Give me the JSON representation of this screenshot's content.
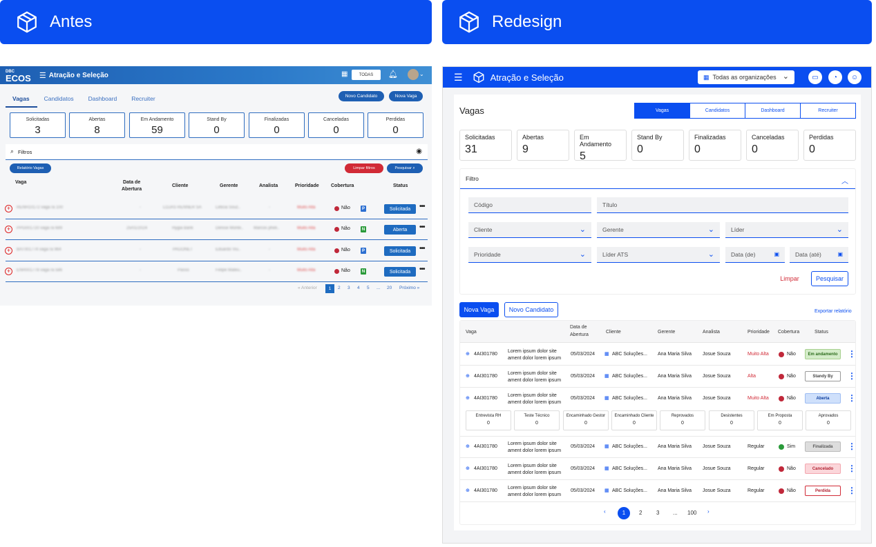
{
  "banners": {
    "before": "Antes",
    "after": "Redesign"
  },
  "old": {
    "logo_small": "DBC",
    "logo": "ECOS",
    "title": "Atração e Seleção",
    "org": "TODAS",
    "tabs": [
      "Vagas",
      "Candidatos",
      "Dashboard",
      "Recruiter"
    ],
    "btn_new_candidate": "Novo Candidato",
    "btn_new_job": "Nova Vaga",
    "cards": [
      {
        "label": "Solicitadas",
        "value": "3"
      },
      {
        "label": "Abertas",
        "value": "8"
      },
      {
        "label": "Em Andamento",
        "value": "59"
      },
      {
        "label": "Stand By",
        "value": "0"
      },
      {
        "label": "Finalizadas",
        "value": "0"
      },
      {
        "label": "Canceladas",
        "value": "0"
      },
      {
        "label": "Perdidas",
        "value": "0"
      }
    ],
    "filter_label": "Filtros",
    "btn_report": "Relatório Vagas",
    "btn_clear": "Limpar filtros",
    "btn_search": "Pesquisar",
    "headers": {
      "vaga": "Vaga",
      "data1": "Data de",
      "data2": "Abertura",
      "cliente": "Cliente",
      "gerente": "Gerente",
      "analista": "Analista",
      "prioridade": "Prioridade",
      "cobertura": "Cobertura",
      "status": "Status"
    },
    "rows": [
      {
        "vaga": "RENH10172 vaga ra 100",
        "data": "-",
        "cliente": "LOJAS RENNER SA",
        "gerente": "Leticia Souz..",
        "analista": "-",
        "prioridade": "Muito Alta",
        "cobertura": "Não",
        "pic": "P",
        "status": "Solicitada"
      },
      {
        "vaga": "PPG001720 vaga ra 689",
        "data": "25/01/2024",
        "cliente": "Hygia Bank",
        "gerente": "Denise Monte..",
        "analista": "Marcos pheli..",
        "prioridade": "Muito Alta",
        "cobertura": "Não",
        "pic": "N",
        "status": "Aberta"
      },
      {
        "vaga": "BAT001774 vaga ra 964",
        "data": "-",
        "cliente": "PAGONET",
        "gerente": "Eduardo Viu..",
        "analista": "-",
        "prioridade": "Muito Alta",
        "cobertura": "Não",
        "pic": "P",
        "status": "Solicitada"
      },
      {
        "vaga": "ENR001778 vaga ra 586",
        "data": "-",
        "cliente": "Passo",
        "gerente": "Felipe Mateu..",
        "analista": "-",
        "prioridade": "Muito Alta",
        "cobertura": "Não",
        "pic": "N",
        "status": "Solicitada"
      }
    ],
    "pagination": {
      "prev": "« Anterior",
      "pages": [
        "1",
        "2",
        "3",
        "4",
        "5",
        "...",
        "20"
      ],
      "next": "Próximo »"
    }
  },
  "new": {
    "title": "Atração e Seleção",
    "org": "Todas as organizações",
    "heading": "Vagas",
    "tabs": [
      "Vagas",
      "Candidatos",
      "Dashboard",
      "Recruiter"
    ],
    "cards": [
      {
        "label": "Solicitadas",
        "value": "31"
      },
      {
        "label": "Abertas",
        "value": "9"
      },
      {
        "label": "Em Andamento",
        "value": "5"
      },
      {
        "label": "Stand By",
        "value": "0"
      },
      {
        "label": "Finalizadas",
        "value": "0"
      },
      {
        "label": "Canceladas",
        "value": "0"
      },
      {
        "label": "Perdidas",
        "value": "0"
      }
    ],
    "filter": {
      "title": "Filtro",
      "codigo": "Código",
      "titulo": "Título",
      "cliente": "Cliente",
      "gerente": "Gerente",
      "lider": "Líder",
      "prioridade": "Prioridade",
      "lider_ats": "Líder ATS",
      "data_de": "Data (de)",
      "data_ate": "Data (até)",
      "limpar": "Limpar",
      "pesquisar": "Pesquisar"
    },
    "btn_new_job": "Nova Vaga",
    "btn_new_candidate": "Novo Candidato",
    "export": "Exportar relatório",
    "headers": {
      "vaga": "Vaga",
      "data1": "Data de",
      "data2": "Abertura",
      "cliente": "Cliente",
      "gerente": "Gerente",
      "analista": "Analista",
      "prioridade": "Prioridade",
      "cobertura": "Cobertura",
      "status": "Status"
    },
    "rows": [
      {
        "code": "4AI301780",
        "desc1": "Lorem ipsum dolor site",
        "desc2": "ament dolor lorem ipsum",
        "data": "05/03/2024",
        "cliente": "ABC Soluções...",
        "gerente": "Ana Maria Silva",
        "analista": "Josue Souza",
        "prioridade": "Muito Alta",
        "cobertura": "Não",
        "status": "Em andamento"
      },
      {
        "code": "4AI301780",
        "desc1": "Lorem ipsum dolor site",
        "desc2": "ament dolor lorem ipsum",
        "data": "05/03/2024",
        "cliente": "ABC Soluções...",
        "gerente": "Ana Maria Silva",
        "analista": "Josue Souza",
        "prioridade": "Alta",
        "cobertura": "Não",
        "status": "Standy By"
      },
      {
        "code": "4AI301780",
        "desc1": "Lorem ipsum dolor site",
        "desc2": "ament dolor lorem ipsum",
        "data": "05/03/2024",
        "cliente": "ABC Soluções...",
        "gerente": "Ana Maria Silva",
        "analista": "Josue Souza",
        "prioridade": "Muito Alta",
        "cobertura": "Não",
        "status": "Aberta"
      },
      {
        "code": "4AI301780",
        "desc1": "Lorem ipsum dolor site",
        "desc2": "ament dolor lorem ipsum",
        "data": "05/03/2024",
        "cliente": "ABC Soluções...",
        "gerente": "Ana Maria Silva",
        "analista": "Josue Souza",
        "prioridade": "Regular",
        "cobertura": "Sim",
        "status": "Finalizada"
      },
      {
        "code": "4AI301780",
        "desc1": "Lorem ipsum dolor site",
        "desc2": "ament dolor lorem ipsum",
        "data": "05/03/2024",
        "cliente": "ABC Soluções...",
        "gerente": "Ana Maria Silva",
        "analista": "Josue Souza",
        "prioridade": "Regular",
        "cobertura": "Não",
        "status": "Cancelado"
      },
      {
        "code": "4AI301780",
        "desc1": "Lorem ipsum dolor site",
        "desc2": "ament dolor lorem ipsum",
        "data": "05/03/2024",
        "cliente": "ABC Soluções...",
        "gerente": "Ana Maria Silva",
        "analista": "Josue Souza",
        "prioridade": "Regular",
        "cobertura": "Não",
        "status": "Perdida"
      }
    ],
    "stages": [
      {
        "label": "Entrevista RH",
        "value": "0"
      },
      {
        "label": "Teste Técnico",
        "value": "0"
      },
      {
        "label": "Encaminhado Gestor",
        "value": "0"
      },
      {
        "label": "Encaminhado Cliente",
        "value": "0"
      },
      {
        "label": "Reprovados",
        "value": "0"
      },
      {
        "label": "Desistentes",
        "value": "0"
      },
      {
        "label": "Em Proposta",
        "value": "0"
      },
      {
        "label": "Aprovados",
        "value": "0"
      }
    ],
    "pagination": {
      "pages": [
        "1",
        "2",
        "3",
        "...",
        "100"
      ]
    }
  }
}
